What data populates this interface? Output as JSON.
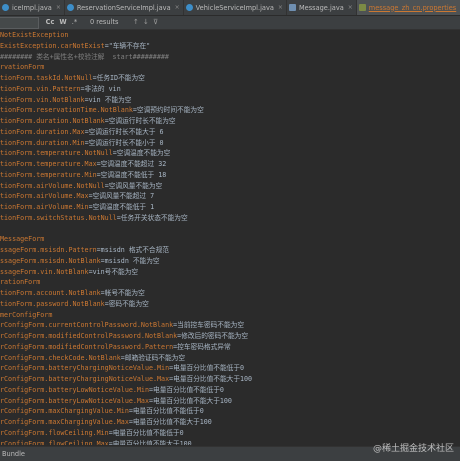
{
  "tabs": [
    {
      "label": "iceImpl.java",
      "icon": "class-icon",
      "active": false
    },
    {
      "label": "ReservationServiceImpl.java",
      "icon": "class-icon",
      "active": false
    },
    {
      "label": "VehicleServiceImpl.java",
      "icon": "class-icon",
      "active": false
    },
    {
      "label": "Message.java",
      "icon": "java-file-icon",
      "active": false
    },
    {
      "label": "message_zh_cn.properties",
      "icon": "properties-file-icon",
      "active": true
    },
    {
      "label": "ConsumerService",
      "icon": "class-icon",
      "active": false
    }
  ],
  "search": {
    "match_case": "Cc",
    "words": "W",
    "regex": ".*",
    "result": "0 results"
  },
  "code_lines": [
    {
      "key": "NotExistException",
      "val": ""
    },
    {
      "key": "ExistException.carNotExist",
      "val": "=\"车辆不存在\""
    },
    {
      "key": "",
      "val": "######## 类名+属性名+校验注解  start#########",
      "comment": true
    },
    {
      "key": "rvationForm",
      "val": ""
    },
    {
      "key": "tionForm.taskId.NotNull",
      "val": "=任务ID不能为空"
    },
    {
      "key": "tionForm.vin.Pattern",
      "val": "=非法的 vin"
    },
    {
      "key": "tionForm.vin.NotBlank",
      "val": "=vin 不能为空"
    },
    {
      "key": "tionForm.reservationTime.NotBlank",
      "val": "=空调预约时间不能为空"
    },
    {
      "key": "tionForm.duration.NotBlank",
      "val": "=空调运行时长不能为空"
    },
    {
      "key": "tionForm.duration.Max",
      "val": "=空调运行时长不能大于 6"
    },
    {
      "key": "tionForm.duration.Min",
      "val": "=空调运行时长不能小于 0"
    },
    {
      "key": "tionForm.temperature.NotNull",
      "val": "=空调温度不能为空"
    },
    {
      "key": "tionForm.temperature.Max",
      "val": "=空调温度不能超过 32"
    },
    {
      "key": "tionForm.temperature.Min",
      "val": "=空调温度不能低于 18"
    },
    {
      "key": "tionForm.airVolume.NotNull",
      "val": "=空调风量不能为空"
    },
    {
      "key": "tionForm.airVolume.Max",
      "val": "=空调风量不能超过 7"
    },
    {
      "key": "tionForm.airVolume.Min",
      "val": "=空调温度不能低于 1"
    },
    {
      "key": "tionForm.switchStatus.NotNull",
      "val": "=任务开关状态不能为空"
    },
    {
      "key": "",
      "val": ""
    },
    {
      "key": "MessageForm",
      "val": ""
    },
    {
      "key": "ssageForm.msisdn.Pattern",
      "val": "=msisdn 格式不合规范"
    },
    {
      "key": "ssageForm.msisdn.NotBlank",
      "val": "=msisdn 不能为空"
    },
    {
      "key": "ssageForm.vin.NotBlank",
      "val": "=vin号不能为空"
    },
    {
      "key": "rationForm",
      "val": ""
    },
    {
      "key": "tionForm.account.NotBlank",
      "val": "=帐号不能为空"
    },
    {
      "key": "tionForm.password.NotBlank",
      "val": "=密码不能为空"
    },
    {
      "key": "merConfigForm",
      "val": ""
    },
    {
      "key": "rConfigForm.currentControlPassword.NotBlank",
      "val": "=当前控车密码不能为空"
    },
    {
      "key": "rConfigForm.modifiedControlPassword.NotBlank",
      "val": "=修改后的密码不能为空"
    },
    {
      "key": "rConfigForm.modifiedControlPassword.Pattern",
      "val": "=控车密码格式异常"
    },
    {
      "key": "rConfigForm.checkCode.NotBlank",
      "val": "=邮箱验证码不能为空"
    },
    {
      "key": "rConfigForm.batteryChargingNoticeValue.Min",
      "val": "=电量百分比值不能低于0"
    },
    {
      "key": "rConfigForm.batteryChargingNoticeValue.Max",
      "val": "=电量百分比值不能大于100"
    },
    {
      "key": "rConfigForm.batteryLowNoticeValue.Min",
      "val": "=电量百分比值不能低于0"
    },
    {
      "key": "rConfigForm.batteryLowNoticeValue.Max",
      "val": "=电量百分比值不能大于100"
    },
    {
      "key": "rConfigForm.maxChargingValue.Min",
      "val": "=电量百分比值不能低于0"
    },
    {
      "key": "rConfigForm.maxChargingValue.Max",
      "val": "=电量百分比值不能大于100"
    },
    {
      "key": "rConfigForm.flowCeiling.Min",
      "val": "=电量百分比值不能低于0"
    },
    {
      "key": "rConfigForm.flowCeiling.Max",
      "val": "=电量百分比值不能大于100"
    }
  ],
  "status": {
    "label": "Bundle"
  },
  "watermark": "@稀土掘金技术社区",
  "colors": {
    "key": "#cc7832",
    "value": "#a9b7c6",
    "comment": "#808080",
    "background": "#2b2b2b"
  }
}
